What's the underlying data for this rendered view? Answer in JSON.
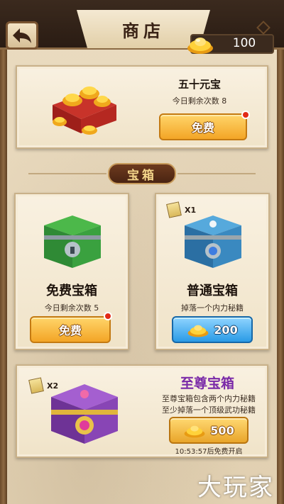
{
  "header": {
    "title": "商店",
    "gold_amount": "100"
  },
  "ingot_offer": {
    "title": "五十元宝",
    "remaining": "今日剩余次数 8",
    "button_label": "免费"
  },
  "section": {
    "banner": "宝箱"
  },
  "free_chest": {
    "title": "免费宝箱",
    "remaining": "今日剩余次数 5",
    "button_label": "免费"
  },
  "normal_chest": {
    "book_count": "X1",
    "title": "普通宝箱",
    "description": "掉落一个内力秘籍",
    "price": "200"
  },
  "supreme_chest": {
    "book_count": "X2",
    "title": "至尊宝箱",
    "description_line1": "至尊宝箱包含两个内力秘籍",
    "description_line2": "至少掉落一个顶级武功秘籍",
    "price": "500",
    "timer": "10:53:57后免费开启"
  },
  "watermark": "大玩家",
  "icons": {
    "back": "back-arrow-icon",
    "gold": "gold-ingot-icon",
    "book": "skill-book-icon",
    "badge": "red-dot-icon"
  },
  "colors": {
    "supreme_title": "#7a2aa8",
    "orange_button": "#f3a526",
    "blue_button": "#2a9be6",
    "badge": "#e22a17"
  }
}
